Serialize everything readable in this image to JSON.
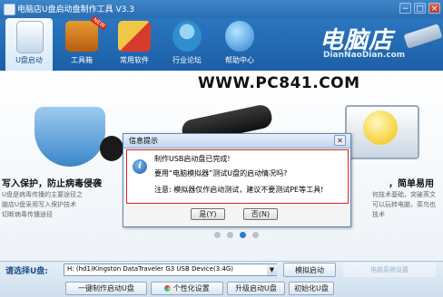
{
  "window": {
    "title": "电脑店U盘启动盘制作工具 V3.3"
  },
  "toolbar": {
    "items": [
      {
        "label": "U盘启动"
      },
      {
        "label": "工具箱"
      },
      {
        "label": "常用软件"
      },
      {
        "label": "行业论坛"
      },
      {
        "label": "帮助中心"
      }
    ],
    "new_badge": "NEW"
  },
  "brand": {
    "logo": "电脑店",
    "site": "DianNaoDian.com"
  },
  "watermark": "WWW.PC841.COM",
  "features": {
    "left_heading": "写入保护，防止病毒侵袭",
    "left_desc_1": "U盘是病毒传播的主要途径之",
    "left_desc_2": "脑店U盘采用写入保护技术",
    "left_desc_3": "切断病毒传播途径",
    "right_heading": "，简单易用",
    "right_desc_1": "何技术基础，突破英文",
    "right_desc_2": "可以玩转电脑，菜鸟也",
    "right_desc_3": "技术"
  },
  "dialog": {
    "title": "信息提示",
    "line1": "制作USB启动盘已完成!",
    "line2": "要用“电脑模拟器”测试U盘的启动情况吗?",
    "line3": "注意: 模拟器仅作启动测试，建议不要测试PE等工具!",
    "yes": "是(Y)",
    "no": "否(N)"
  },
  "bottom": {
    "select_label": "请选择U盘:",
    "device": "H: (hd1)Kingston DataTraveler G3 USB Device(3.4G)",
    "simulator_button": "模拟启动",
    "faint_text": "电脑系统设置"
  },
  "actions": {
    "make": "一键制作启动U盘",
    "personal": "个性化设置",
    "upgrade": "升级启动U盘",
    "format": "初始化U盘"
  }
}
